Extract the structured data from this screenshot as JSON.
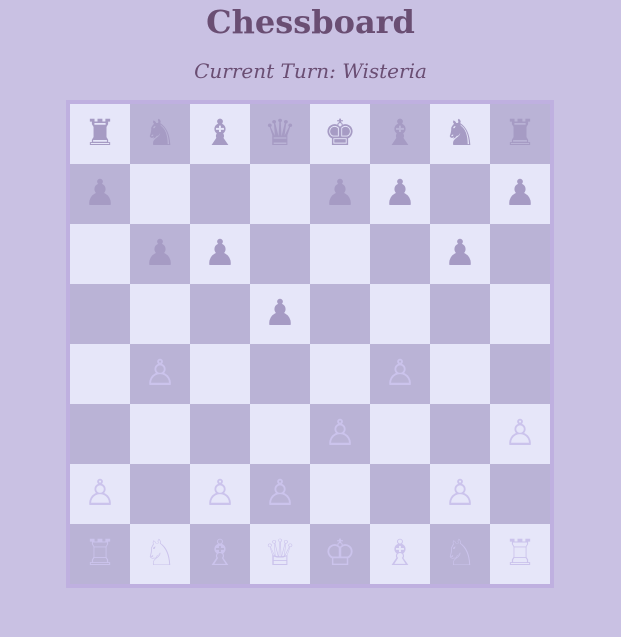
{
  "header": {
    "title": "Chessboard",
    "turn_text": "Current Turn: Wisteria"
  },
  "colors": {
    "background": "#c9c1e3",
    "light_square": "#e6e6f9",
    "dark_square": "#bab3d6",
    "black_piece": "#a69bc4",
    "white_piece": "#cbc3ec",
    "text": "#6a4e73"
  },
  "board": {
    "rows": [
      [
        {
          "p": "♜",
          "side": "black",
          "name": "rook"
        },
        {
          "p": "♞",
          "side": "black",
          "name": "knight"
        },
        {
          "p": "♝",
          "side": "black",
          "name": "bishop"
        },
        {
          "p": "♛",
          "side": "black",
          "name": "queen"
        },
        {
          "p": "♚",
          "side": "black",
          "name": "king"
        },
        {
          "p": "♝",
          "side": "black",
          "name": "bishop"
        },
        {
          "p": "♞",
          "side": "black",
          "name": "knight"
        },
        {
          "p": "♜",
          "side": "black",
          "name": "rook"
        }
      ],
      [
        {
          "p": "♟",
          "side": "black",
          "name": "pawn"
        },
        null,
        null,
        null,
        {
          "p": "♟",
          "side": "black",
          "name": "pawn"
        },
        {
          "p": "♟",
          "side": "black",
          "name": "pawn"
        },
        null,
        {
          "p": "♟",
          "side": "black",
          "name": "pawn"
        }
      ],
      [
        null,
        {
          "p": "♟",
          "side": "black",
          "name": "pawn"
        },
        {
          "p": "♟",
          "side": "black",
          "name": "pawn"
        },
        null,
        null,
        null,
        {
          "p": "♟",
          "side": "black",
          "name": "pawn"
        },
        null
      ],
      [
        null,
        null,
        null,
        {
          "p": "♟",
          "side": "black",
          "name": "pawn"
        },
        null,
        null,
        null,
        null
      ],
      [
        null,
        {
          "p": "♙",
          "side": "white",
          "name": "pawn"
        },
        null,
        null,
        null,
        {
          "p": "♙",
          "side": "white",
          "name": "pawn"
        },
        null,
        null
      ],
      [
        null,
        null,
        null,
        null,
        {
          "p": "♙",
          "side": "white",
          "name": "pawn"
        },
        null,
        null,
        {
          "p": "♙",
          "side": "white",
          "name": "pawn"
        }
      ],
      [
        {
          "p": "♙",
          "side": "white",
          "name": "pawn"
        },
        null,
        {
          "p": "♙",
          "side": "white",
          "name": "pawn"
        },
        {
          "p": "♙",
          "side": "white",
          "name": "pawn"
        },
        null,
        null,
        {
          "p": "♙",
          "side": "white",
          "name": "pawn"
        },
        null
      ],
      [
        {
          "p": "♖",
          "side": "white",
          "name": "rook"
        },
        {
          "p": "♘",
          "side": "white",
          "name": "knight"
        },
        {
          "p": "♗",
          "side": "white",
          "name": "bishop"
        },
        {
          "p": "♕",
          "side": "white",
          "name": "queen"
        },
        {
          "p": "♔",
          "side": "white",
          "name": "king"
        },
        {
          "p": "♗",
          "side": "white",
          "name": "bishop"
        },
        {
          "p": "♘",
          "side": "white",
          "name": "knight"
        },
        {
          "p": "♖",
          "side": "white",
          "name": "rook"
        }
      ]
    ]
  }
}
